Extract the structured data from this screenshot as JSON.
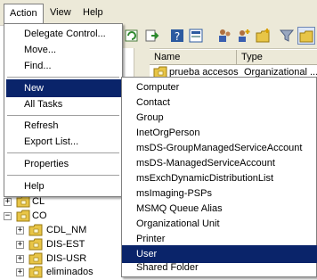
{
  "menubar": {
    "items": [
      "Action",
      "View",
      "Help"
    ]
  },
  "list": {
    "columns": [
      "Name",
      "Type"
    ],
    "rows": [
      {
        "name": "prueba accesos",
        "type": "Organizational ..."
      }
    ]
  },
  "tree": {
    "items": [
      {
        "label": "CL",
        "expander": "+"
      },
      {
        "label": "CO",
        "expander": "−"
      },
      {
        "label": "CDL_NM",
        "expander": "+"
      },
      {
        "label": "DIS-EST",
        "expander": "+"
      },
      {
        "label": "DIS-USR",
        "expander": "+"
      },
      {
        "label": "eliminados",
        "expander": "+"
      }
    ]
  },
  "action_menu": {
    "items": [
      "Delegate Control...",
      "Move...",
      "Find...",
      "New",
      "All Tasks",
      "Refresh",
      "Export List...",
      "Properties",
      "Help"
    ]
  },
  "new_submenu": {
    "items": [
      "Computer",
      "Contact",
      "Group",
      "InetOrgPerson",
      "msDS-GroupManagedServiceAccount",
      "msDS-ManagedServiceAccount",
      "msExchDynamicDistributionList",
      "msImaging-PSPs",
      "MSMQ Queue Alias",
      "Organizational Unit",
      "Printer",
      "User",
      "Shared Folder"
    ],
    "highlighted": "User"
  },
  "colors": {
    "highlight": "#0a246a",
    "menubar": "#ece9d8",
    "folder": "#e8c547"
  }
}
